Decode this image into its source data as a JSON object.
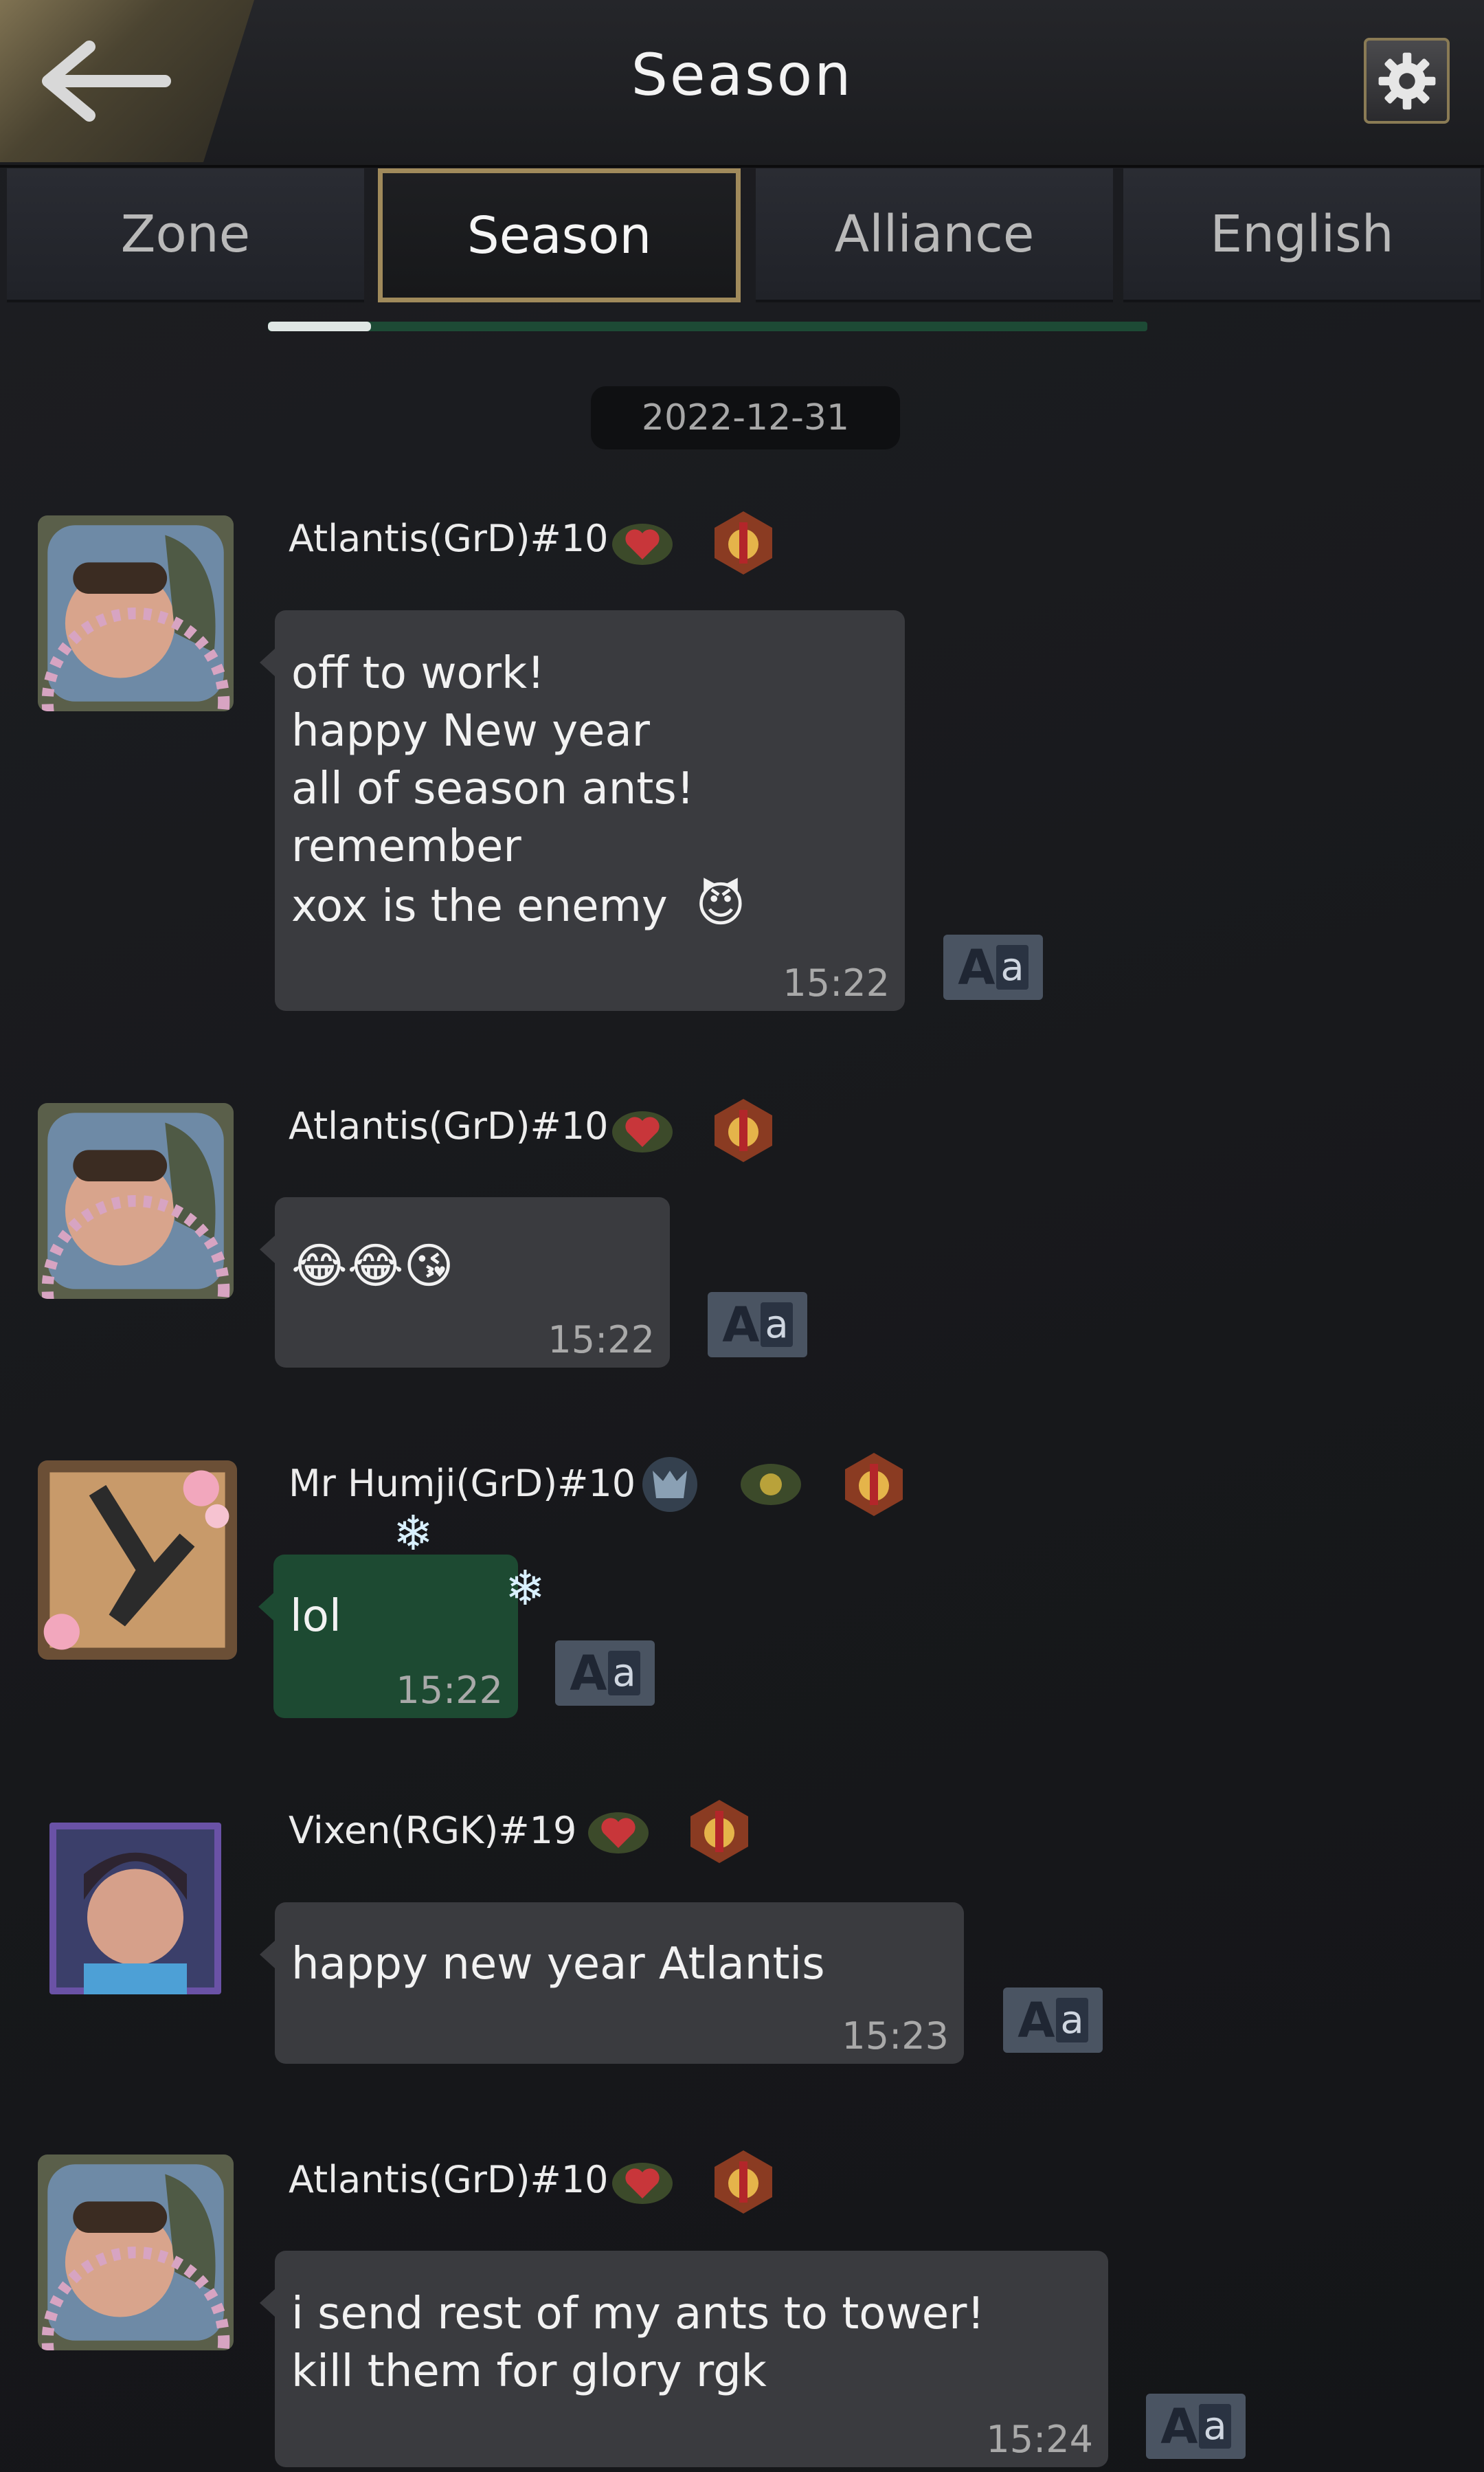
{
  "header": {
    "title": "Season"
  },
  "tabs": [
    {
      "label": "Zone",
      "active": false
    },
    {
      "label": "Season",
      "active": true
    },
    {
      "label": "Alliance",
      "active": false
    },
    {
      "label": "English",
      "active": false
    }
  ],
  "date_divider": "2022-12-31",
  "translate_button": {
    "label_big": "A",
    "label_small": "a"
  },
  "messages": [
    {
      "sender": "Atlantis(GrD)#10",
      "lines": [
        "off to work!",
        "happy New year",
        "all of season ants!",
        "remember",
        "xox is the enemy"
      ],
      "emoji": "😈",
      "time": "15:22"
    },
    {
      "sender": "Atlantis(GrD)#10",
      "lines": [],
      "emoji": "😂😂😘",
      "time": "15:22"
    },
    {
      "sender": "Mr Humji(GrD)#10",
      "lines": [
        "lol"
      ],
      "time": "15:22"
    },
    {
      "sender": "Vixen(RGK)#19",
      "lines": [
        "happy new year Atlantis"
      ],
      "time": "15:23"
    },
    {
      "sender": "Atlantis(GrD)#10",
      "lines": [
        "i send rest of my ants to tower!",
        "kill them for glory rgk"
      ],
      "time": "15:24"
    }
  ],
  "colors": {
    "accent_gold": "#a08a5b",
    "bubble": "#3a3b3f",
    "bubble_green": "#1d4a32",
    "background": "#1a1b1e"
  }
}
